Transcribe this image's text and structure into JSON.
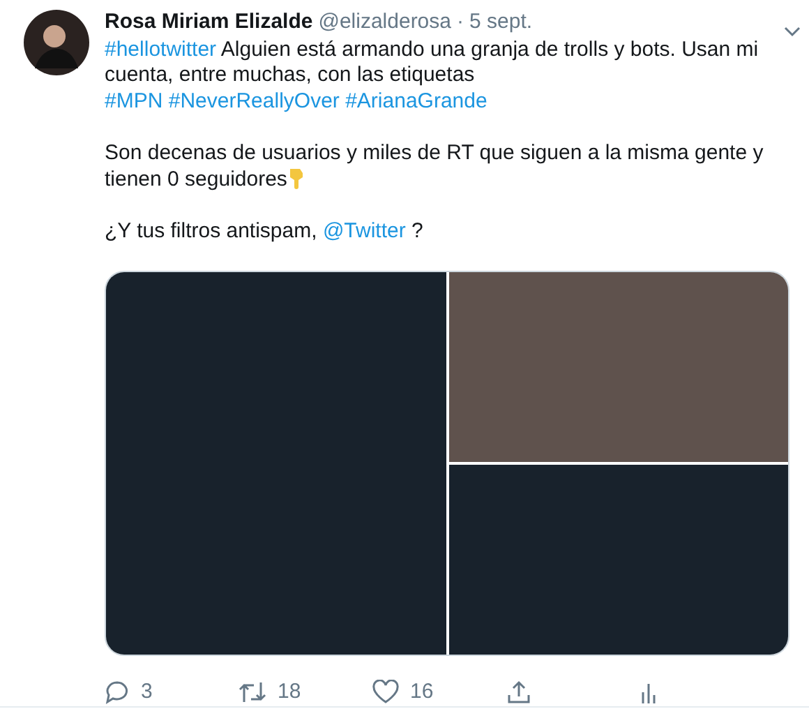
{
  "tweet": {
    "name": "Rosa Miriam Elizalde",
    "handle": "@elizalderosa",
    "separator": "·",
    "date": "5 sept.",
    "paragraphs": [
      [
        {
          "kind": "hashtag",
          "text": "#hellotwitter"
        },
        {
          "kind": "text",
          "text": " Alguien está armando una granja de trolls y bots. Usan mi cuenta, entre muchas, con las etiquetas"
        },
        {
          "kind": "break"
        },
        {
          "kind": "hashtag",
          "text": "#MPN"
        },
        {
          "kind": "space"
        },
        {
          "kind": "hashtag",
          "text": "#NeverReallyOver"
        },
        {
          "kind": "space"
        },
        {
          "kind": "hashtag",
          "text": "#ArianaGrande"
        }
      ],
      [
        {
          "kind": "text",
          "text": "Son decenas de usuarios y miles de RT que siguen a la misma gente y tienen 0 seguidores"
        },
        {
          "kind": "emoji"
        }
      ],
      [
        {
          "kind": "text",
          "text": "¿Y tus filtros antispam, "
        },
        {
          "kind": "mention",
          "text": "@Twitter"
        },
        {
          "kind": "text",
          "text": " ?"
        }
      ]
    ],
    "media": [
      {
        "color": "#18222c"
      },
      {
        "color": "#5f524d"
      },
      {
        "color": "#18222c"
      }
    ],
    "actions": [
      {
        "kind": "reply",
        "count": "3"
      },
      {
        "kind": "retweet",
        "count": "18"
      },
      {
        "kind": "like",
        "count": "16"
      },
      {
        "kind": "share"
      },
      {
        "kind": "analytics"
      }
    ]
  }
}
